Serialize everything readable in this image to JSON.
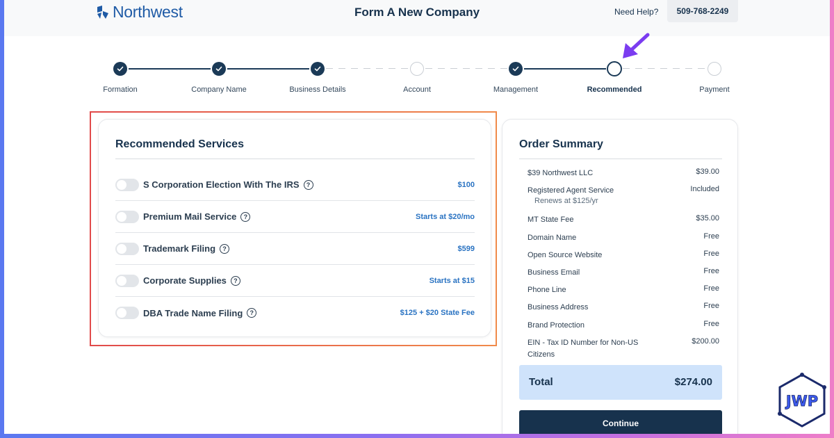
{
  "header": {
    "brand": "Northwest",
    "title": "Form A New Company",
    "help_label": "Need Help?",
    "phone": "509-768-2249"
  },
  "steps": [
    {
      "label": "Formation",
      "state": "done"
    },
    {
      "label": "Company Name",
      "state": "done"
    },
    {
      "label": "Business Details",
      "state": "done"
    },
    {
      "label": "Account",
      "state": "todo"
    },
    {
      "label": "Management",
      "state": "done"
    },
    {
      "label": "Recommended",
      "state": "current"
    },
    {
      "label": "Payment",
      "state": "todo"
    }
  ],
  "recommended": {
    "title": "Recommended Services",
    "services": [
      {
        "name": "S Corporation Election With The IRS",
        "price": "$100",
        "enabled": false
      },
      {
        "name": "Premium Mail Service",
        "price": "Starts at $20/mo",
        "enabled": false
      },
      {
        "name": "Trademark Filing",
        "price": "$599",
        "enabled": false
      },
      {
        "name": "Corporate Supplies",
        "price": "Starts at $15",
        "enabled": false
      },
      {
        "name": "DBA Trade Name Filing",
        "price": "$125 + $20 State Fee",
        "enabled": false
      }
    ]
  },
  "summary": {
    "title": "Order Summary",
    "items": [
      {
        "label": "$39 Northwest LLC",
        "amount": "$39.00"
      },
      {
        "label": "Registered Agent Service",
        "amount": "Included",
        "sub": "Renews at $125/yr"
      },
      {
        "label": "MT State Fee",
        "amount": "$35.00"
      },
      {
        "label": "Domain Name",
        "amount": "Free"
      },
      {
        "label": "Open Source Website",
        "amount": "Free"
      },
      {
        "label": "Business Email",
        "amount": "Free"
      },
      {
        "label": "Phone Line",
        "amount": "Free"
      },
      {
        "label": "Business Address",
        "amount": "Free"
      },
      {
        "label": "Brand Protection",
        "amount": "Free"
      },
      {
        "label": "EIN - Tax ID Number for Non-US Citizens",
        "amount": "$200.00"
      }
    ],
    "total_label": "Total",
    "total_amount": "$274.00",
    "continue_label": "Continue"
  },
  "watermark": {
    "text": "JWP"
  },
  "colors": {
    "navy": "#17324d",
    "link_blue": "#2a73c2",
    "total_bg": "#cfe3fb",
    "highlight_red": "#e14a4a",
    "arrow_purple": "#7b3cf0"
  }
}
